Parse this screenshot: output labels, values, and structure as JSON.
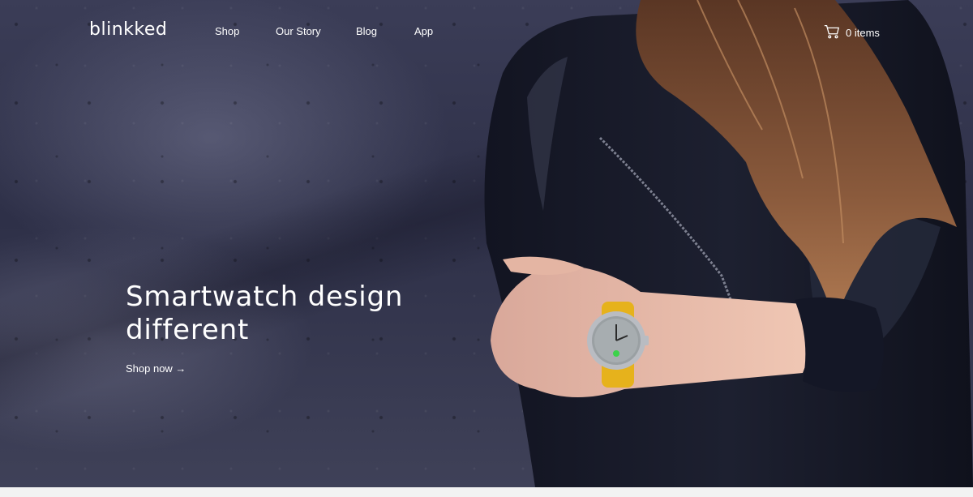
{
  "header": {
    "logo": "blinkked",
    "nav": [
      {
        "label": "Shop"
      },
      {
        "label": "Our Story"
      },
      {
        "label": "Blog"
      },
      {
        "label": "App"
      }
    ],
    "cart": {
      "icon": "cart-icon",
      "label": "0 items"
    }
  },
  "hero": {
    "headline_line1": "Smartwatch design",
    "headline_line2": "different",
    "cta": "Shop now →"
  },
  "colors": {
    "background": "#34364e",
    "text": "#ffffff",
    "watch_strap": "#e6b21c",
    "watch_indicator": "#3bd24a"
  }
}
